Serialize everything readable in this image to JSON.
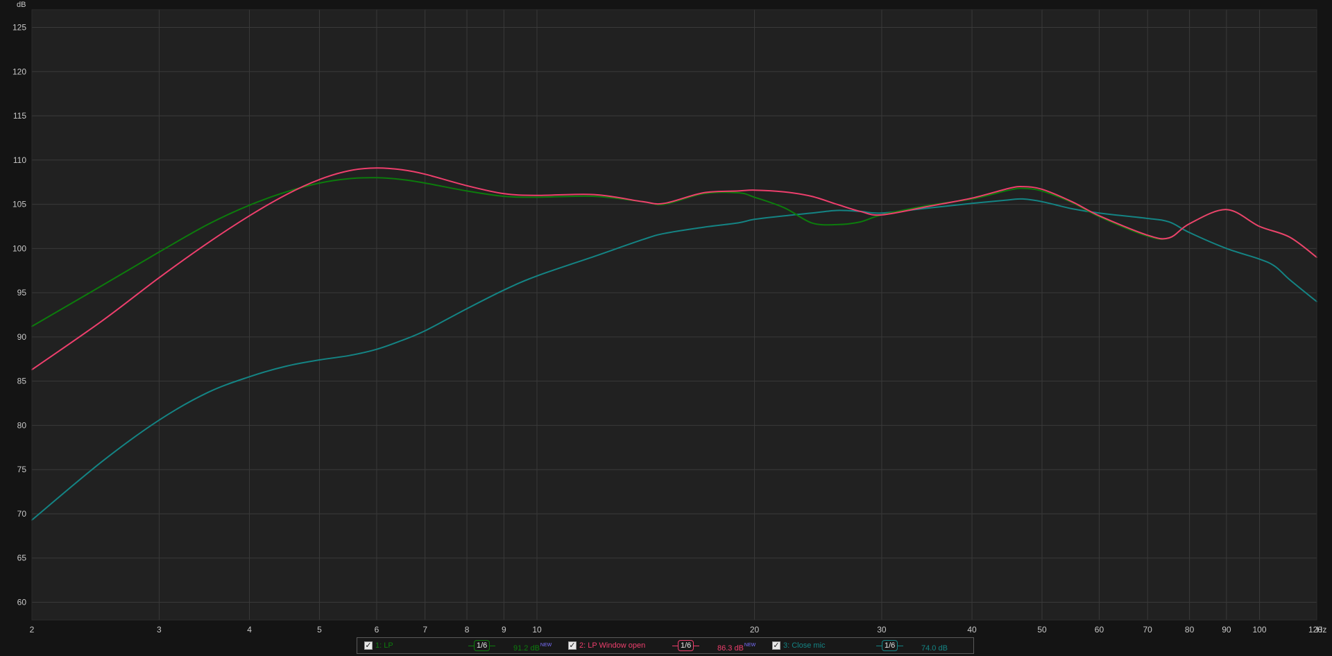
{
  "chart_data": {
    "type": "line",
    "ylabel": "dB",
    "xlabel": "Hz",
    "x_scale": "log",
    "xlim": [
      2,
      120
    ],
    "ylim": [
      58,
      127
    ],
    "grid": true,
    "x_ticks": [
      2,
      3,
      4,
      5,
      6,
      7,
      8,
      9,
      10,
      20,
      30,
      40,
      50,
      60,
      70,
      80,
      90,
      100,
      120
    ],
    "x_tick_labels": [
      "2",
      "3",
      "4",
      "5",
      "6",
      "7",
      "8",
      "9",
      "10",
      "20",
      "30",
      "40",
      "50",
      "60",
      "70",
      "80",
      "90",
      "100",
      "120"
    ],
    "y_ticks": [
      60,
      65,
      70,
      75,
      80,
      85,
      90,
      95,
      100,
      105,
      110,
      115,
      120,
      125
    ],
    "y_tick_labels": [
      "60",
      "65",
      "70",
      "75",
      "80",
      "85",
      "90",
      "95",
      "100",
      "105",
      "110",
      "115",
      "120",
      "125"
    ],
    "series": [
      {
        "name": "1: LP",
        "color": "#0c7c0c",
        "x": [
          2,
          2.5,
          3,
          3.5,
          4,
          4.5,
          5,
          5.5,
          6,
          6.5,
          7,
          8,
          9,
          10,
          12,
          14,
          15,
          17,
          19,
          20,
          22,
          24,
          26,
          28,
          30,
          35,
          40,
          45,
          47,
          50,
          55,
          60,
          70,
          75,
          80,
          90,
          100,
          110,
          120
        ],
        "y": [
          91.2,
          95.8,
          99.6,
          102.7,
          104.9,
          106.4,
          107.4,
          107.9,
          108.0,
          107.8,
          107.4,
          106.5,
          105.9,
          105.8,
          105.9,
          105.3,
          105.0,
          106.2,
          106.3,
          105.8,
          104.6,
          102.9,
          102.7,
          103.0,
          103.8,
          104.9,
          105.6,
          106.6,
          106.8,
          106.5,
          105.2,
          103.6,
          101.4,
          101.2,
          102.8,
          104.4,
          102.5,
          101.3,
          99.0
        ]
      },
      {
        "name": "2: LP Window open",
        "color": "#ee3f6d",
        "x": [
          2,
          2.5,
          3,
          3.5,
          4,
          4.5,
          5,
          5.5,
          6,
          6.5,
          7,
          8,
          9,
          10,
          12,
          14,
          15,
          17,
          19,
          20,
          22,
          24,
          26,
          28,
          30,
          35,
          40,
          45,
          47,
          50,
          55,
          60,
          70,
          75,
          80,
          90,
          100,
          110,
          120
        ],
        "y": [
          86.3,
          91.8,
          96.7,
          100.6,
          103.7,
          106.1,
          107.8,
          108.8,
          109.1,
          108.9,
          108.4,
          107.1,
          106.2,
          106.0,
          106.1,
          105.3,
          105.1,
          106.3,
          106.5,
          106.6,
          106.4,
          105.9,
          105.0,
          104.2,
          103.8,
          104.8,
          105.7,
          106.8,
          107.0,
          106.7,
          105.3,
          103.7,
          101.5,
          101.2,
          102.8,
          104.4,
          102.5,
          101.3,
          99.0
        ]
      },
      {
        "name": "3: Close mic",
        "color": "#148484",
        "x": [
          2,
          2.5,
          3,
          3.5,
          4,
          4.5,
          5,
          5.5,
          6,
          6.5,
          7,
          8,
          9,
          10,
          12,
          14,
          15,
          17,
          19,
          20,
          22,
          24,
          26,
          28,
          30,
          35,
          40,
          45,
          47,
          50,
          55,
          60,
          70,
          75,
          80,
          90,
          100,
          105,
          110,
          120
        ],
        "y": [
          69.3,
          75.9,
          80.6,
          83.7,
          85.5,
          86.7,
          87.4,
          87.9,
          88.6,
          89.6,
          90.7,
          93.2,
          95.3,
          96.9,
          99.1,
          101.0,
          101.7,
          102.4,
          102.9,
          103.3,
          103.7,
          104.0,
          104.3,
          104.2,
          104.0,
          104.6,
          105.1,
          105.5,
          105.6,
          105.3,
          104.5,
          104.0,
          103.4,
          103.0,
          101.8,
          100.0,
          98.8,
          98.0,
          96.5,
          94.0
        ]
      }
    ]
  },
  "legend": [
    {
      "checked": "✓",
      "name": "1: LP",
      "smoothing": "1/6",
      "level": "91.2 dB",
      "badge": "NEW"
    },
    {
      "checked": "✓",
      "name": "2: LP Window open",
      "smoothing": "1/6",
      "level": "86.3 dB",
      "badge": "NEW"
    },
    {
      "checked": "✓",
      "name": "3: Close mic",
      "smoothing": "1/6",
      "level": "74.0 dB",
      "badge": ""
    }
  ]
}
